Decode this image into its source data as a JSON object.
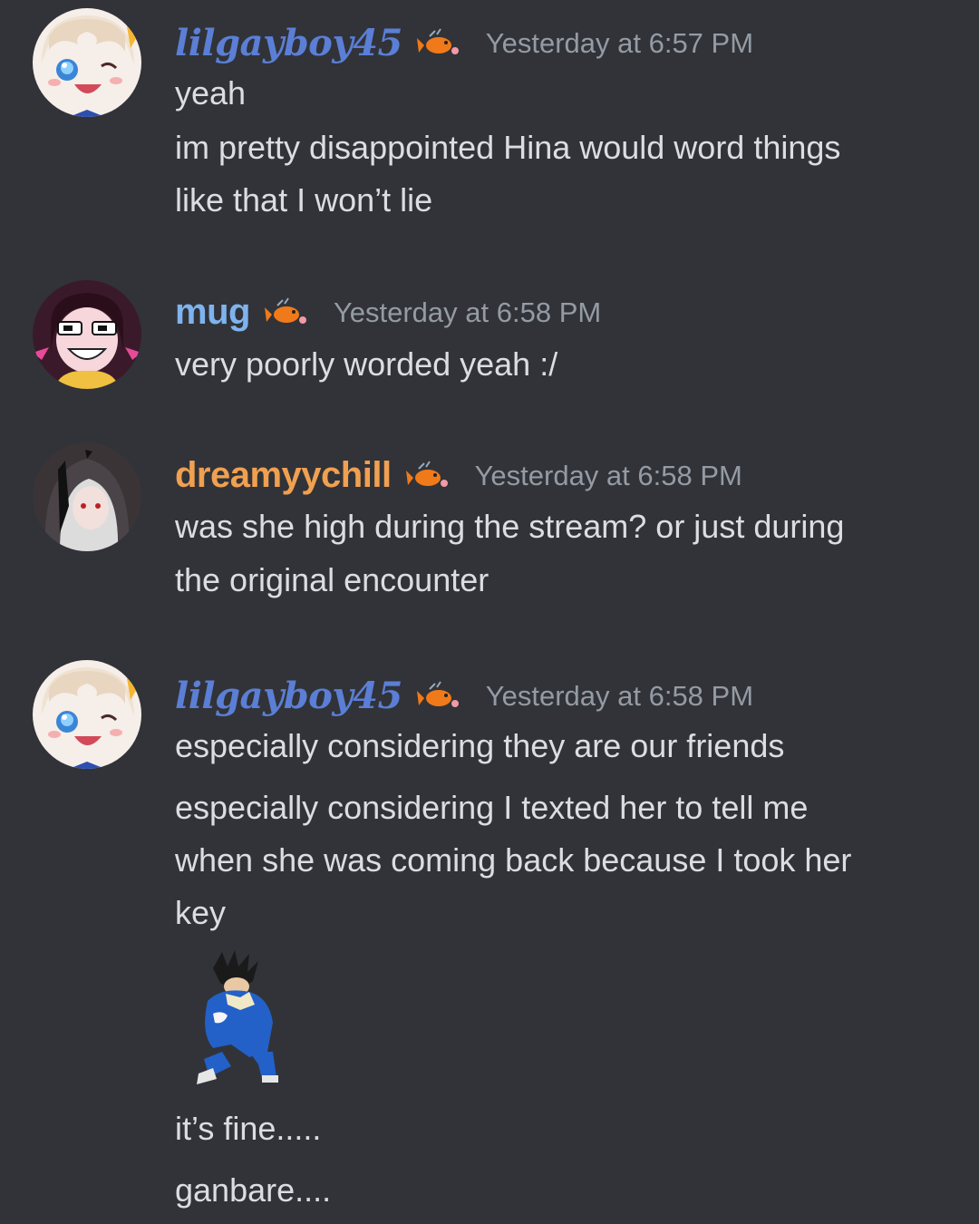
{
  "colors": {
    "background": "#313338",
    "user_lilgayboy": "#5b7fd6",
    "user_mug": "#7fb3ee",
    "user_dreamyychill": "#f0a050",
    "timestamp": "#949ba4",
    "text": "#dbdee1"
  },
  "messages": [
    {
      "author": "lilgayboy45",
      "badge_icon": "goldfish-badge-icon",
      "timestamp": "Yesterday at 6:57 PM",
      "lines": [
        "yeah",
        "im pretty disappointed Hina would word things",
        "like that I won’t lie"
      ]
    },
    {
      "author": "mug",
      "badge_icon": "goldfish-badge-icon",
      "timestamp": "Yesterday at 6:58 PM",
      "lines": [
        "very poorly worded yeah :/"
      ]
    },
    {
      "author": "dreamyychill",
      "badge_icon": "goldfish-badge-icon",
      "timestamp": "Yesterday at 6:58 PM",
      "lines": [
        "was she high during the stream? or just during",
        "the original encounter"
      ]
    },
    {
      "author": "lilgayboy45",
      "badge_icon": "goldfish-badge-icon",
      "timestamp": "Yesterday at 6:58 PM",
      "lines": [
        "especially considering they are our friends",
        "especially considering I texted her to tell me",
        "when she was coming back because I took her",
        "key",
        "it’s fine.....",
        "ganbare...."
      ],
      "sticker_icon": "crouching-saiyan-sticker-icon"
    }
  ]
}
